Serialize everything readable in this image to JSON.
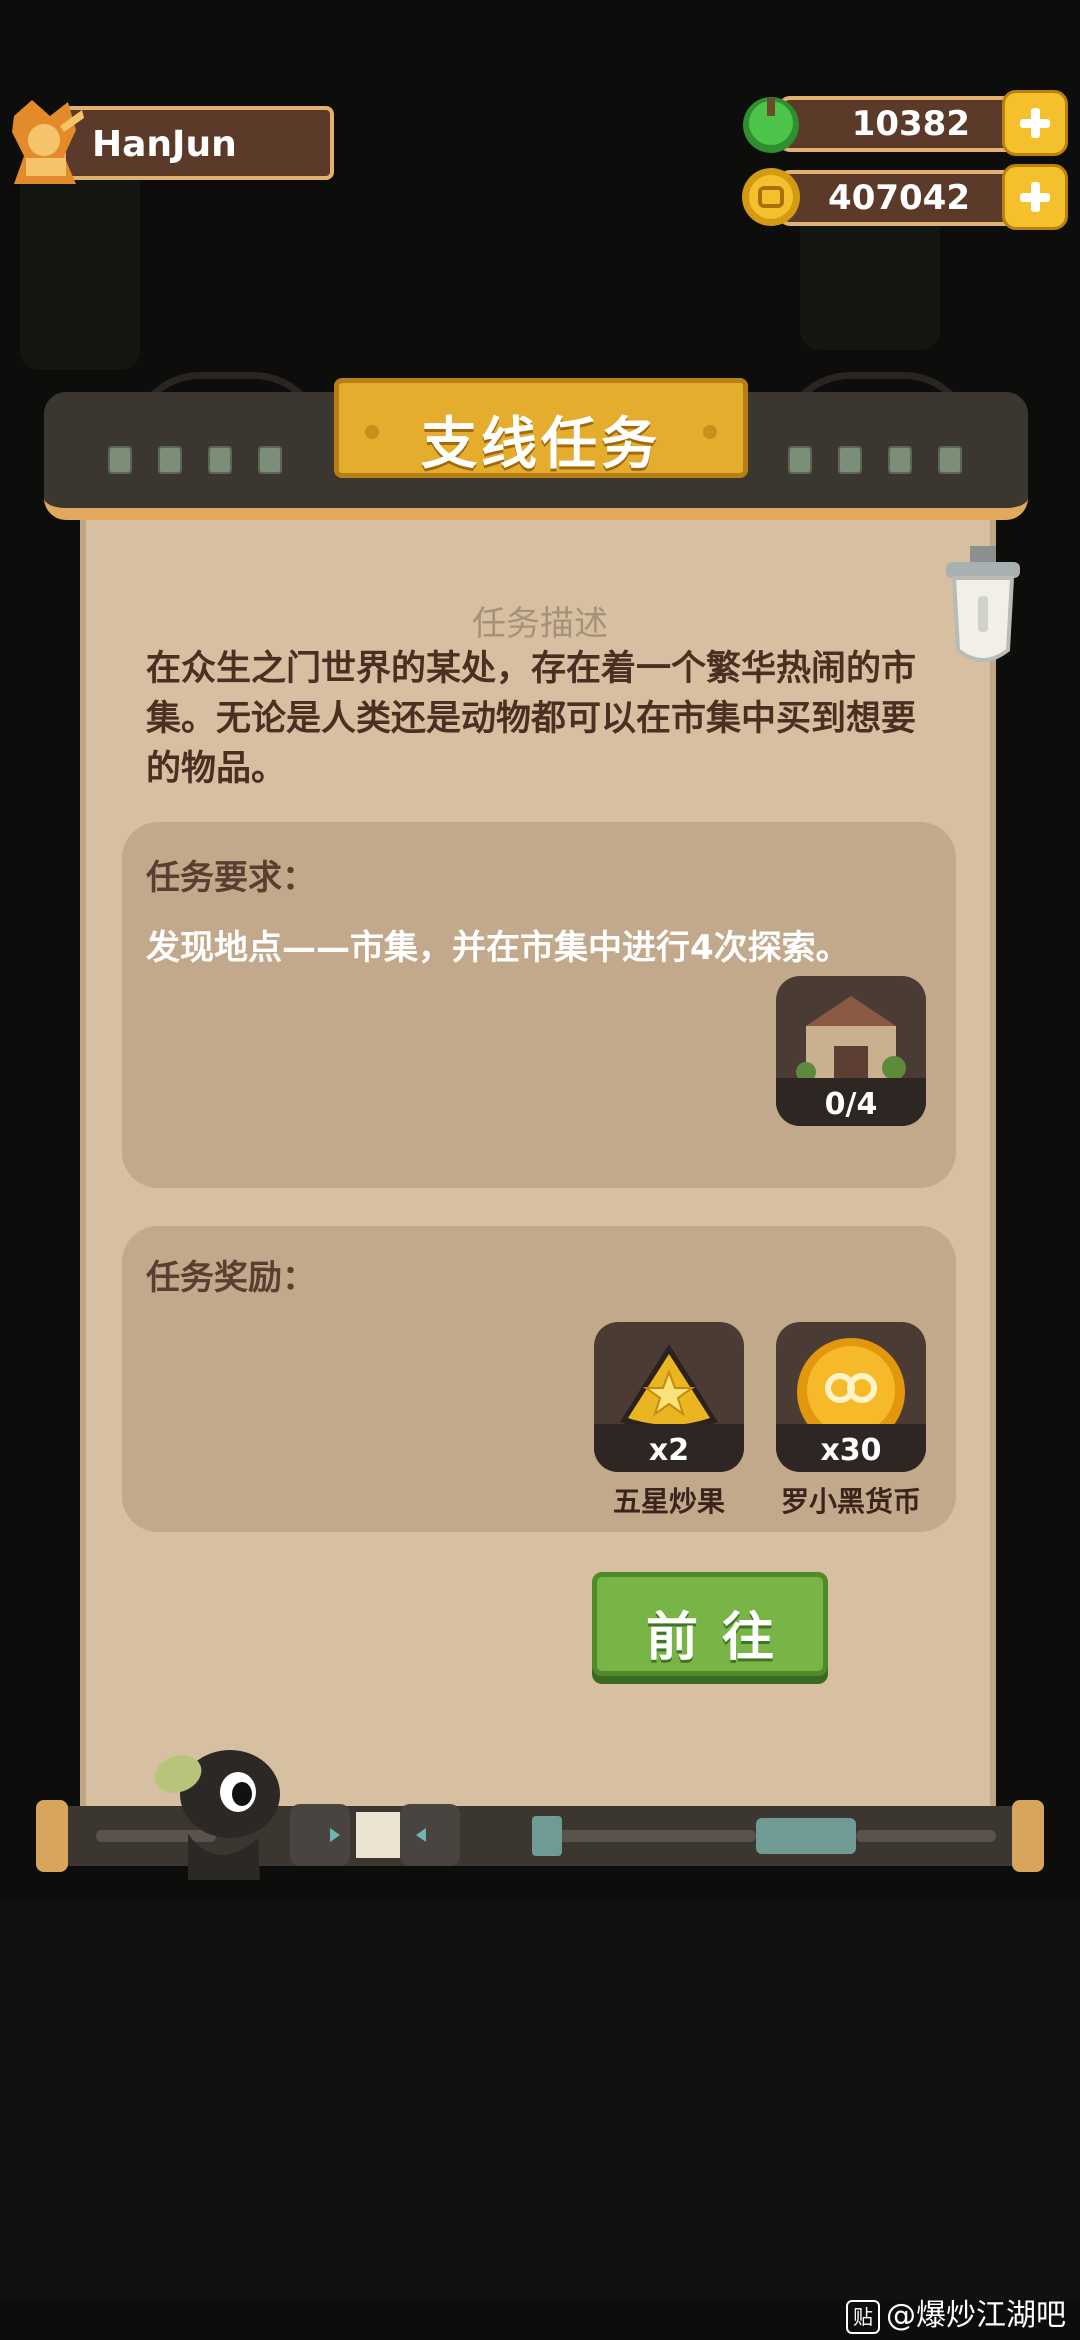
{
  "player": {
    "name": "HanJun"
  },
  "currencies": [
    {
      "name": "gem",
      "value": "10382",
      "color": "#3fae3a"
    },
    {
      "name": "coin",
      "value": "407042",
      "color": "#f5c02e"
    }
  ],
  "panel": {
    "title": "支线任务",
    "description_title": "任务描述",
    "description": "在众生之门世界的某处，存在着一个繁华热闹的市集。无论是人类还是动物都可以在市集中买到想要的物品。",
    "requirement_label": "任务要求：",
    "requirement_text": "发现地点——市集，并在市集中进行4次探索。",
    "requirement_progress": "0/4",
    "reward_label": "任务奖励：",
    "rewards": [
      {
        "count": "x2",
        "name": "五星炒果",
        "icon": "star-nut-icon"
      },
      {
        "count": "x30",
        "name": "罗小黑货币",
        "icon": "luoxiaohei-coin-icon"
      }
    ],
    "go_button": "前往"
  },
  "watermark": "@爆炒江湖吧",
  "watermark_icon": "贴",
  "colors": {
    "paper": "#d7bfa1",
    "card": "#c3a98c",
    "title_plate": "#e4ad2e",
    "go_button": "#78b546"
  }
}
